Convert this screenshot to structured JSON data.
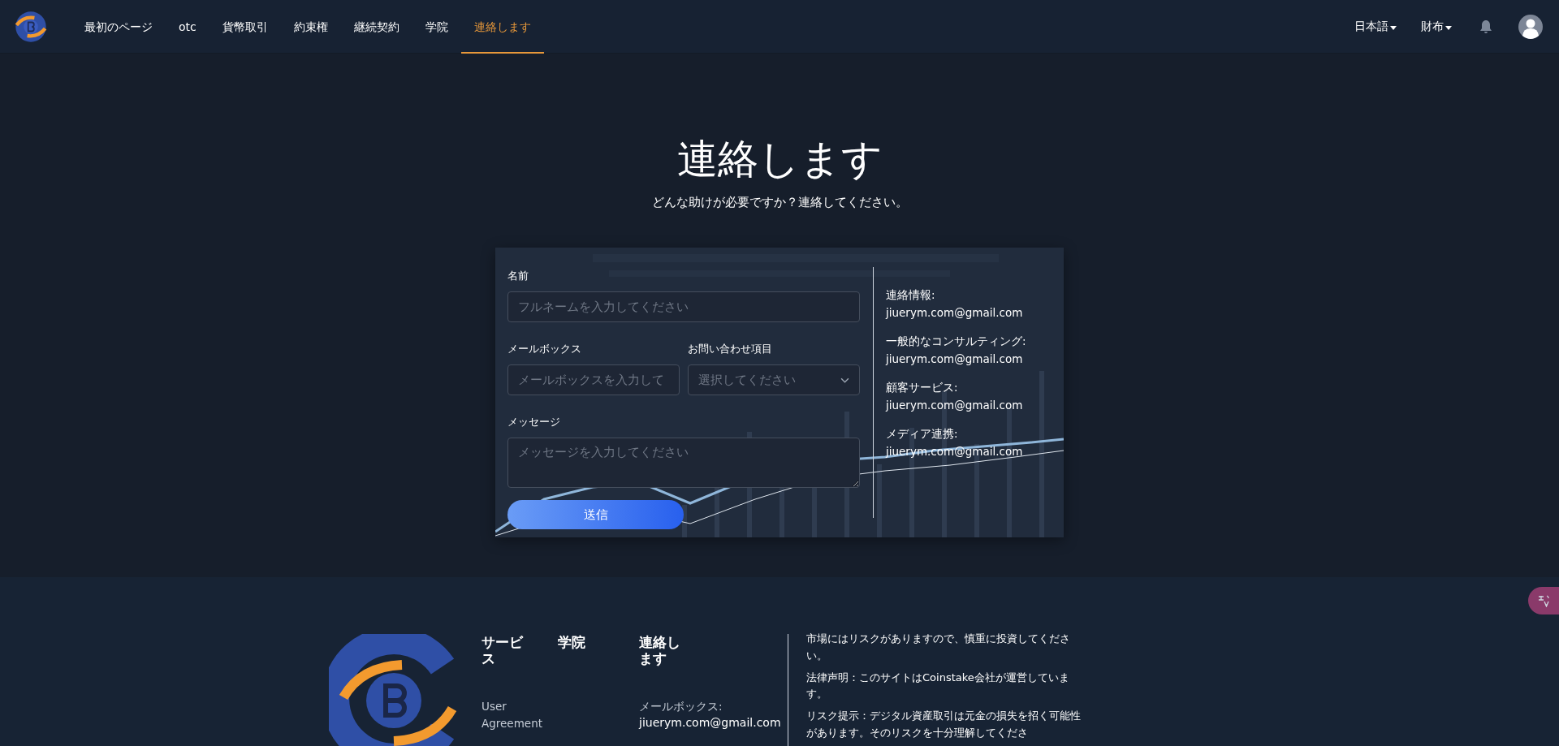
{
  "nav": {
    "items": [
      {
        "label": "最初のページ",
        "selected": false
      },
      {
        "label": "otc",
        "selected": false
      },
      {
        "label": "貨幣取引",
        "selected": false
      },
      {
        "label": "約束権",
        "selected": false
      },
      {
        "label": "継続契約",
        "selected": false
      },
      {
        "label": "学院",
        "selected": false
      },
      {
        "label": "連絡します",
        "selected": true
      }
    ],
    "menus": [
      "日本語",
      "財布"
    ]
  },
  "hero": {
    "title": "連絡します",
    "subtitle": "どんな助けが必要ですか？連絡してください。"
  },
  "form": {
    "fields": [
      {
        "kind": "text",
        "label": "名前",
        "placeholder": "フルネームを入力してください"
      },
      {
        "kind": "text",
        "label": "メールボックス",
        "placeholder": "メールボックスを入力して"
      },
      {
        "kind": "select",
        "label": "お問い合わせ項目",
        "placeholder": "選択してください"
      },
      {
        "kind": "textarea",
        "label": "メッセージ",
        "placeholder": "メッセージを入力してください"
      }
    ],
    "submit": "送信",
    "contacts": [
      {
        "label": "連絡情報:",
        "value": "jiuerym.com@gmail.com"
      },
      {
        "label": "一般的なコンサルティング:",
        "value": "jiuerym.com@gmail.com"
      },
      {
        "label": "顧客サービス:",
        "value": "jiuerym.com@gmail.com"
      },
      {
        "label": "メディア連携:",
        "value": "jiuerym.com@gmail.com"
      }
    ]
  },
  "footer": {
    "columns": [
      {
        "heading": "サービス",
        "links": [
          "User Agreement"
        ]
      },
      {
        "heading": "学院"
      }
    ],
    "contact": {
      "heading": "連絡します",
      "label": "メールボックス:",
      "value": "jiuerym.com@gmail.com"
    },
    "notices": [
      "市場にはリスクがありますので、慎重に投資してください。",
      "法律声明：このサイトはCoinstake会社が運営しています。",
      "リスク提示：デジタル資産取引は元金の損失を招く可能性があります。そのリスクを十分理解してくださ"
    ]
  }
}
